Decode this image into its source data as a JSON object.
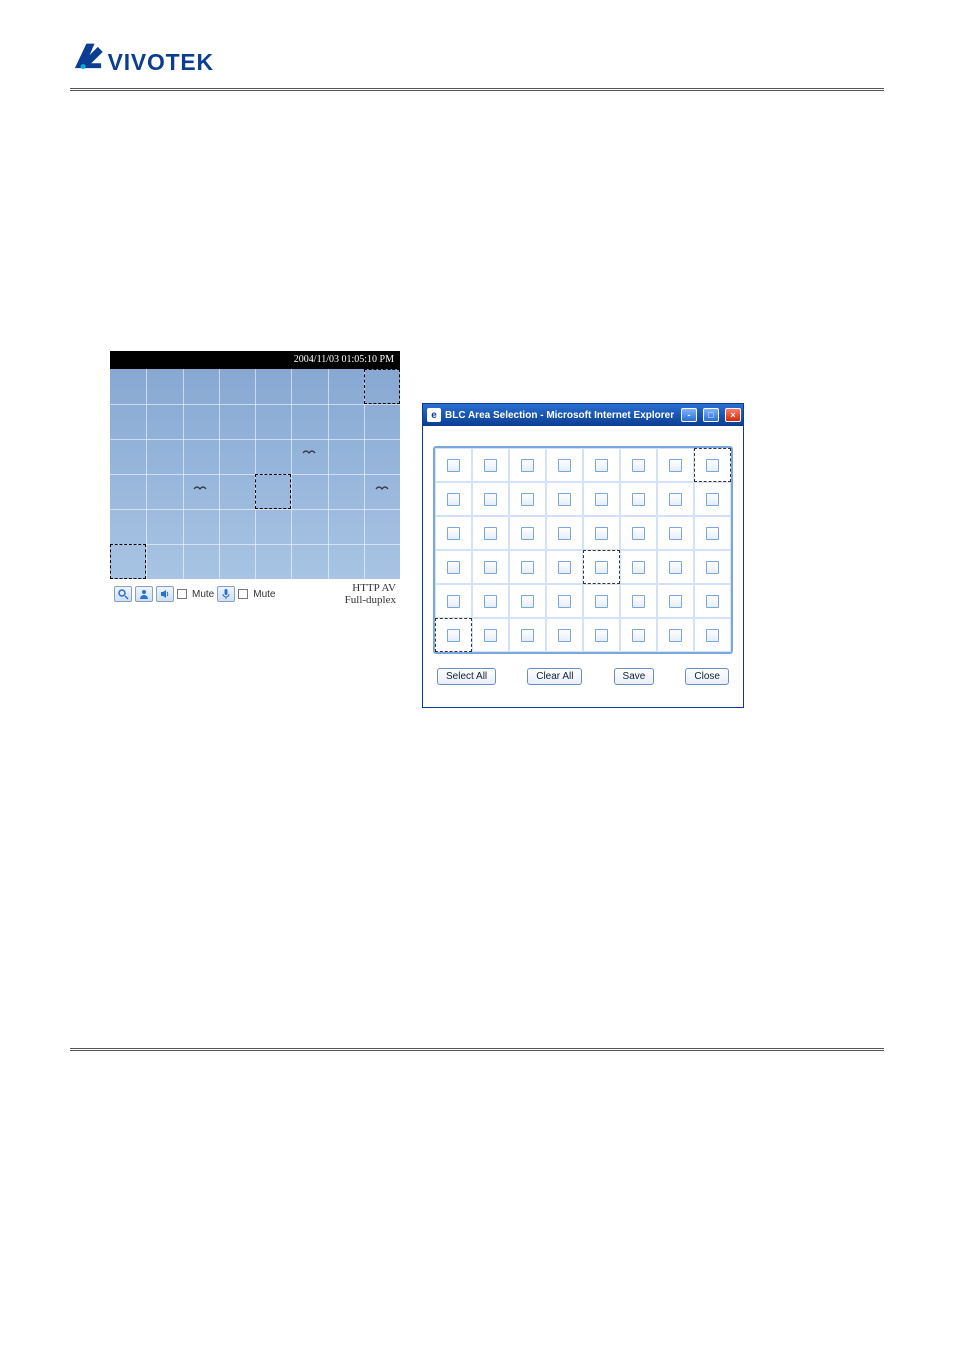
{
  "header": {
    "brand": "VIVOTEK"
  },
  "video": {
    "timestamp": "2004/11/03 01:05:10 PM",
    "grid_cols": 8,
    "grid_rows": 6,
    "highlighted_cells": [
      {
        "row": 0,
        "col": 7
      },
      {
        "row": 3,
        "col": 4
      },
      {
        "row": 5,
        "col": 0
      }
    ],
    "birds": [
      {
        "row": 2,
        "col": 5
      },
      {
        "row": 3,
        "col": 2
      },
      {
        "row": 3,
        "col": 7
      }
    ],
    "toolbar": {
      "mute1_label": "Mute",
      "mute2_label": "Mute",
      "protocol_line1": "HTTP  AV",
      "protocol_line2": "Full-duplex"
    }
  },
  "popup": {
    "title": "BLC Area Selection - Microsoft Internet Explorer",
    "grid_cols": 8,
    "grid_rows": 6,
    "dashed_cells": [
      {
        "row": 0,
        "col": 7
      },
      {
        "row": 3,
        "col": 4
      },
      {
        "row": 5,
        "col": 0
      }
    ],
    "buttons": {
      "select_all": "Select All",
      "clear_all": "Clear All",
      "save": "Save",
      "close": "Close"
    }
  }
}
